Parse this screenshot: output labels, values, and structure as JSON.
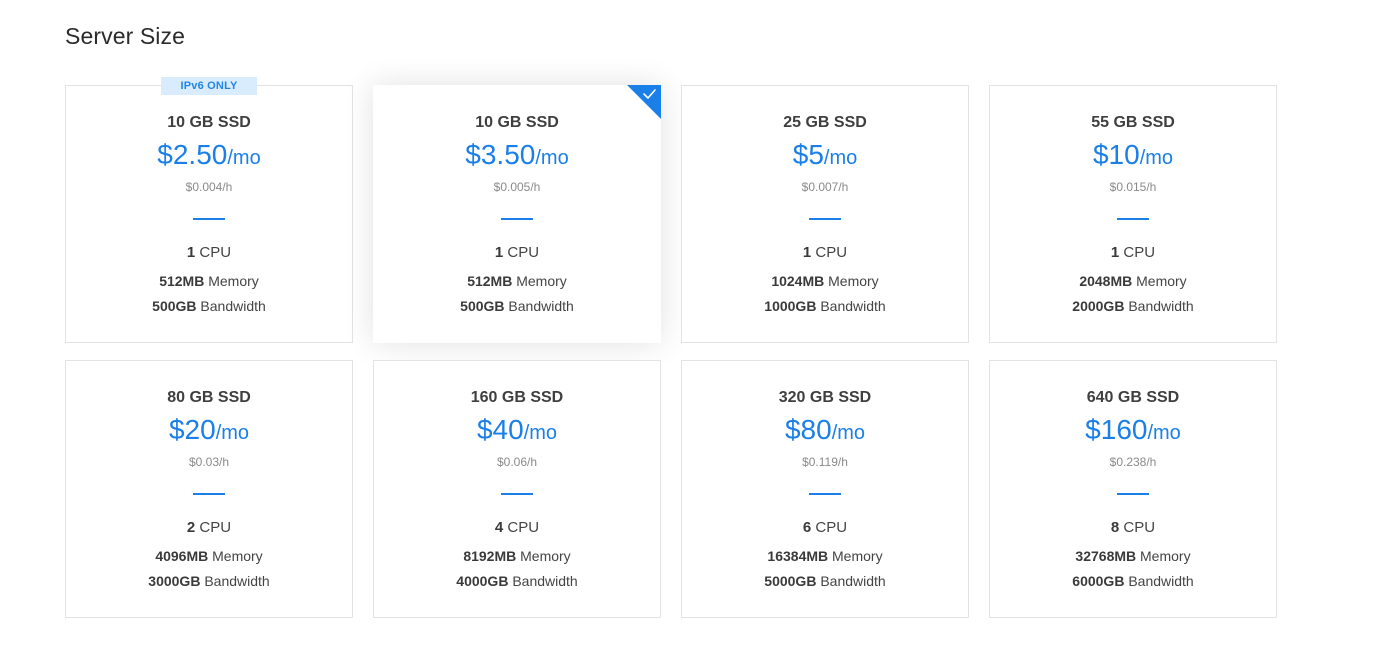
{
  "page": {
    "title": "Server Size"
  },
  "colors": {
    "accent": "#1a7fe8",
    "badge_bg": "#d9ecfd",
    "border": "#e3e3e3"
  },
  "plans": [
    {
      "ssd": "10 GB SSD",
      "price": "$2.50",
      "per": "/mo",
      "hourly": "$0.004/h",
      "cpu_value": "1",
      "cpu_label": "CPU",
      "memory_value": "512MB",
      "memory_label": "Memory",
      "bandwidth_value": "500GB",
      "bandwidth_label": "Bandwidth",
      "badge": "IPv6 ONLY",
      "selected": false
    },
    {
      "ssd": "10 GB SSD",
      "price": "$3.50",
      "per": "/mo",
      "hourly": "$0.005/h",
      "cpu_value": "1",
      "cpu_label": "CPU",
      "memory_value": "512MB",
      "memory_label": "Memory",
      "bandwidth_value": "500GB",
      "bandwidth_label": "Bandwidth",
      "selected": true
    },
    {
      "ssd": "25 GB SSD",
      "price": "$5",
      "per": "/mo",
      "hourly": "$0.007/h",
      "cpu_value": "1",
      "cpu_label": "CPU",
      "memory_value": "1024MB",
      "memory_label": "Memory",
      "bandwidth_value": "1000GB",
      "bandwidth_label": "Bandwidth",
      "selected": false
    },
    {
      "ssd": "55 GB SSD",
      "price": "$10",
      "per": "/mo",
      "hourly": "$0.015/h",
      "cpu_value": "1",
      "cpu_label": "CPU",
      "memory_value": "2048MB",
      "memory_label": "Memory",
      "bandwidth_value": "2000GB",
      "bandwidth_label": "Bandwidth",
      "selected": false
    },
    {
      "ssd": "80 GB SSD",
      "price": "$20",
      "per": "/mo",
      "hourly": "$0.03/h",
      "cpu_value": "2",
      "cpu_label": "CPU",
      "memory_value": "4096MB",
      "memory_label": "Memory",
      "bandwidth_value": "3000GB",
      "bandwidth_label": "Bandwidth",
      "selected": false
    },
    {
      "ssd": "160 GB SSD",
      "price": "$40",
      "per": "/mo",
      "hourly": "$0.06/h",
      "cpu_value": "4",
      "cpu_label": "CPU",
      "memory_value": "8192MB",
      "memory_label": "Memory",
      "bandwidth_value": "4000GB",
      "bandwidth_label": "Bandwidth",
      "selected": false
    },
    {
      "ssd": "320 GB SSD",
      "price": "$80",
      "per": "/mo",
      "hourly": "$0.119/h",
      "cpu_value": "6",
      "cpu_label": "CPU",
      "memory_value": "16384MB",
      "memory_label": "Memory",
      "bandwidth_value": "5000GB",
      "bandwidth_label": "Bandwidth",
      "selected": false
    },
    {
      "ssd": "640 GB SSD",
      "price": "$160",
      "per": "/mo",
      "hourly": "$0.238/h",
      "cpu_value": "8",
      "cpu_label": "CPU",
      "memory_value": "32768MB",
      "memory_label": "Memory",
      "bandwidth_value": "6000GB",
      "bandwidth_label": "Bandwidth",
      "selected": false
    }
  ]
}
